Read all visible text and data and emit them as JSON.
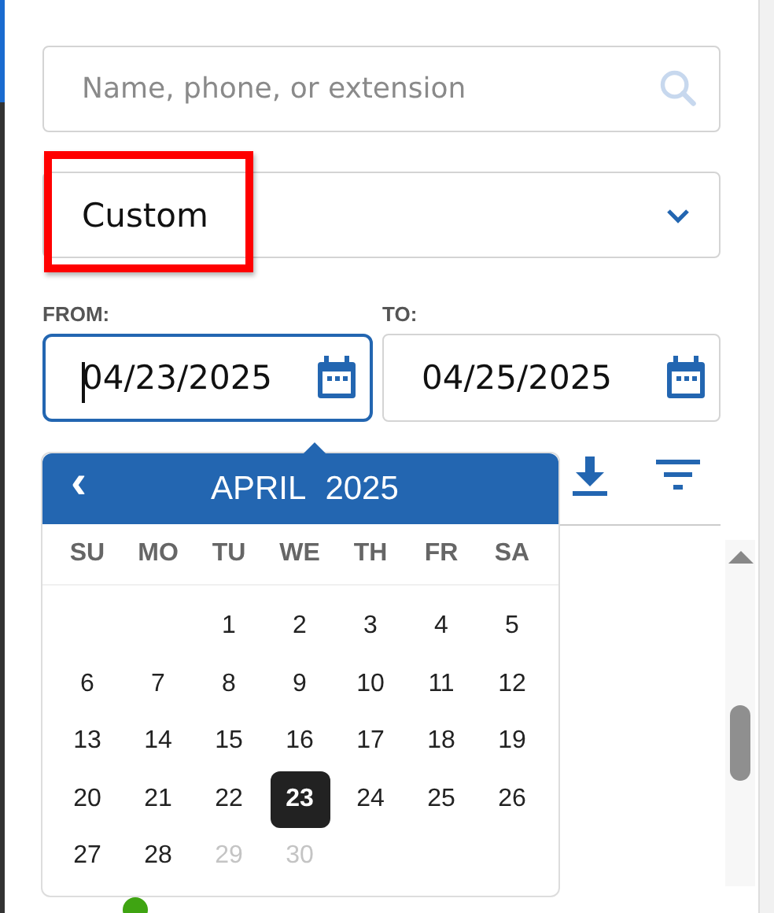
{
  "search": {
    "placeholder": "Name, phone, or extension"
  },
  "range_select": {
    "value": "Custom",
    "highlighted": true
  },
  "from": {
    "label": "FROM:",
    "value": "04/23/2025",
    "focused": true
  },
  "to": {
    "label": "TO:",
    "value": "04/25/2025",
    "focused": false
  },
  "calendar": {
    "month": "APRIL",
    "year": "2025",
    "prev": "‹",
    "weekdays": [
      "SU",
      "MO",
      "TU",
      "WE",
      "TH",
      "FR",
      "SA"
    ],
    "weeks": [
      {
        "kind": "partial",
        "days": [
          {
            "label": "1",
            "selected": false,
            "disabled": false
          },
          {
            "label": "2",
            "selected": false,
            "disabled": false
          },
          {
            "label": "3",
            "selected": false,
            "disabled": false
          },
          {
            "label": "4",
            "selected": false,
            "disabled": false
          },
          {
            "label": "5",
            "selected": false,
            "disabled": false
          }
        ]
      },
      {
        "kind": "full",
        "days": [
          {
            "label": "6",
            "selected": false,
            "disabled": false
          },
          {
            "label": "7",
            "selected": false,
            "disabled": false
          },
          {
            "label": "8",
            "selected": false,
            "disabled": false
          },
          {
            "label": "9",
            "selected": false,
            "disabled": false
          },
          {
            "label": "10",
            "selected": false,
            "disabled": false
          },
          {
            "label": "11",
            "selected": false,
            "disabled": false
          },
          {
            "label": "12",
            "selected": false,
            "disabled": false
          }
        ]
      },
      {
        "kind": "full",
        "days": [
          {
            "label": "13",
            "selected": false,
            "disabled": false
          },
          {
            "label": "14",
            "selected": false,
            "disabled": false
          },
          {
            "label": "15",
            "selected": false,
            "disabled": false
          },
          {
            "label": "16",
            "selected": false,
            "disabled": false
          },
          {
            "label": "17",
            "selected": false,
            "disabled": false
          },
          {
            "label": "18",
            "selected": false,
            "disabled": false
          },
          {
            "label": "19",
            "selected": false,
            "disabled": false
          }
        ]
      },
      {
        "kind": "full",
        "days": [
          {
            "label": "20",
            "selected": false,
            "disabled": false
          },
          {
            "label": "21",
            "selected": false,
            "disabled": false
          },
          {
            "label": "22",
            "selected": false,
            "disabled": false
          },
          {
            "label": "23",
            "selected": true,
            "disabled": false
          },
          {
            "label": "24",
            "selected": false,
            "disabled": false
          },
          {
            "label": "25",
            "selected": false,
            "disabled": false
          },
          {
            "label": "26",
            "selected": false,
            "disabled": false
          }
        ]
      },
      {
        "kind": "tail",
        "days": [
          {
            "label": "27",
            "selected": false,
            "disabled": false
          },
          {
            "label": "28",
            "selected": false,
            "disabled": false
          },
          {
            "label": "29",
            "selected": false,
            "disabled": true
          },
          {
            "label": "30",
            "selected": false,
            "disabled": true
          }
        ]
      }
    ]
  },
  "list": {
    "items": [
      {
        "color": "#3fa412"
      }
    ]
  }
}
